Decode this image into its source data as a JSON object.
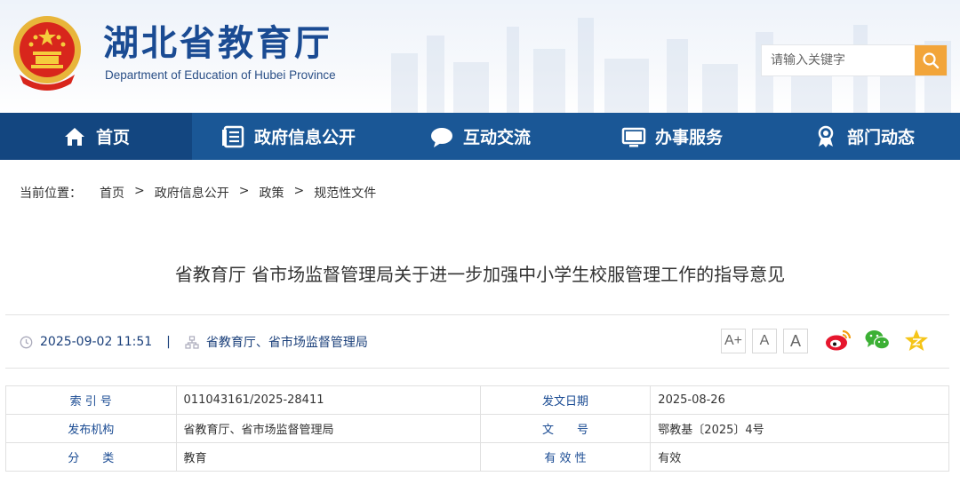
{
  "header": {
    "title": "湖北省教育厅",
    "subtitle": "Department of Education of Hubei Province",
    "search_placeholder": "请输入关键字"
  },
  "nav": {
    "items": [
      {
        "label": "首页",
        "icon": "home-icon"
      },
      {
        "label": "政府信息公开",
        "icon": "document-list-icon"
      },
      {
        "label": "互动交流",
        "icon": "chat-bubble-icon"
      },
      {
        "label": "办事服务",
        "icon": "monitor-icon"
      },
      {
        "label": "部门动态",
        "icon": "award-ribbon-icon"
      }
    ]
  },
  "breadcrumb": {
    "label": "当前位置：",
    "items": [
      "首页",
      "政府信息公开",
      "政策",
      "规范性文件"
    ]
  },
  "article": {
    "title": "省教育厅 省市场监督管理局关于进一步加强中小学生校服管理工作的指导意见",
    "datetime": "2025-09-02 11:51",
    "separator": "|",
    "source": "省教育厅、省市场监督管理局"
  },
  "font_tools": {
    "increase": "A+",
    "reset": "A",
    "decrease": "A"
  },
  "share": [
    "weibo-icon",
    "wechat-icon",
    "qzone-icon"
  ],
  "info": {
    "rows": [
      {
        "k1": "索 引 号",
        "v1": "011043161/2025-28411",
        "k2": "发文日期",
        "v2": "2025-08-26"
      },
      {
        "k1": "发布机构",
        "v1": "省教育厅、省市场监督管理局",
        "k2": "文　　号",
        "v2": "鄂教基〔2025〕4号"
      },
      {
        "k1": "分　　类",
        "v1": "教育",
        "k2": "有 效 性",
        "v2": "有效"
      }
    ]
  },
  "colors": {
    "nav": "#1a5796",
    "nav_active": "#134680",
    "search": "#f2a53a",
    "title_blue": "#1a4b93"
  }
}
